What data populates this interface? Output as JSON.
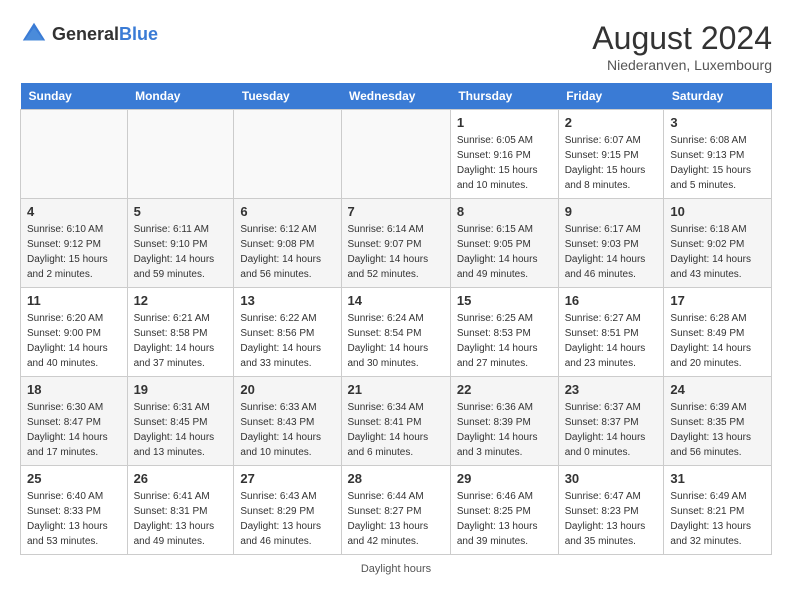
{
  "header": {
    "logo_general": "General",
    "logo_blue": "Blue",
    "month_year": "August 2024",
    "location": "Niederanven, Luxembourg"
  },
  "days_of_week": [
    "Sunday",
    "Monday",
    "Tuesday",
    "Wednesday",
    "Thursday",
    "Friday",
    "Saturday"
  ],
  "weeks": [
    [
      {
        "day": "",
        "info": ""
      },
      {
        "day": "",
        "info": ""
      },
      {
        "day": "",
        "info": ""
      },
      {
        "day": "",
        "info": ""
      },
      {
        "day": "1",
        "info": "Sunrise: 6:05 AM\nSunset: 9:16 PM\nDaylight: 15 hours\nand 10 minutes."
      },
      {
        "day": "2",
        "info": "Sunrise: 6:07 AM\nSunset: 9:15 PM\nDaylight: 15 hours\nand 8 minutes."
      },
      {
        "day": "3",
        "info": "Sunrise: 6:08 AM\nSunset: 9:13 PM\nDaylight: 15 hours\nand 5 minutes."
      }
    ],
    [
      {
        "day": "4",
        "info": "Sunrise: 6:10 AM\nSunset: 9:12 PM\nDaylight: 15 hours\nand 2 minutes."
      },
      {
        "day": "5",
        "info": "Sunrise: 6:11 AM\nSunset: 9:10 PM\nDaylight: 14 hours\nand 59 minutes."
      },
      {
        "day": "6",
        "info": "Sunrise: 6:12 AM\nSunset: 9:08 PM\nDaylight: 14 hours\nand 56 minutes."
      },
      {
        "day": "7",
        "info": "Sunrise: 6:14 AM\nSunset: 9:07 PM\nDaylight: 14 hours\nand 52 minutes."
      },
      {
        "day": "8",
        "info": "Sunrise: 6:15 AM\nSunset: 9:05 PM\nDaylight: 14 hours\nand 49 minutes."
      },
      {
        "day": "9",
        "info": "Sunrise: 6:17 AM\nSunset: 9:03 PM\nDaylight: 14 hours\nand 46 minutes."
      },
      {
        "day": "10",
        "info": "Sunrise: 6:18 AM\nSunset: 9:02 PM\nDaylight: 14 hours\nand 43 minutes."
      }
    ],
    [
      {
        "day": "11",
        "info": "Sunrise: 6:20 AM\nSunset: 9:00 PM\nDaylight: 14 hours\nand 40 minutes."
      },
      {
        "day": "12",
        "info": "Sunrise: 6:21 AM\nSunset: 8:58 PM\nDaylight: 14 hours\nand 37 minutes."
      },
      {
        "day": "13",
        "info": "Sunrise: 6:22 AM\nSunset: 8:56 PM\nDaylight: 14 hours\nand 33 minutes."
      },
      {
        "day": "14",
        "info": "Sunrise: 6:24 AM\nSunset: 8:54 PM\nDaylight: 14 hours\nand 30 minutes."
      },
      {
        "day": "15",
        "info": "Sunrise: 6:25 AM\nSunset: 8:53 PM\nDaylight: 14 hours\nand 27 minutes."
      },
      {
        "day": "16",
        "info": "Sunrise: 6:27 AM\nSunset: 8:51 PM\nDaylight: 14 hours\nand 23 minutes."
      },
      {
        "day": "17",
        "info": "Sunrise: 6:28 AM\nSunset: 8:49 PM\nDaylight: 14 hours\nand 20 minutes."
      }
    ],
    [
      {
        "day": "18",
        "info": "Sunrise: 6:30 AM\nSunset: 8:47 PM\nDaylight: 14 hours\nand 17 minutes."
      },
      {
        "day": "19",
        "info": "Sunrise: 6:31 AM\nSunset: 8:45 PM\nDaylight: 14 hours\nand 13 minutes."
      },
      {
        "day": "20",
        "info": "Sunrise: 6:33 AM\nSunset: 8:43 PM\nDaylight: 14 hours\nand 10 minutes."
      },
      {
        "day": "21",
        "info": "Sunrise: 6:34 AM\nSunset: 8:41 PM\nDaylight: 14 hours\nand 6 minutes."
      },
      {
        "day": "22",
        "info": "Sunrise: 6:36 AM\nSunset: 8:39 PM\nDaylight: 14 hours\nand 3 minutes."
      },
      {
        "day": "23",
        "info": "Sunrise: 6:37 AM\nSunset: 8:37 PM\nDaylight: 14 hours\nand 0 minutes."
      },
      {
        "day": "24",
        "info": "Sunrise: 6:39 AM\nSunset: 8:35 PM\nDaylight: 13 hours\nand 56 minutes."
      }
    ],
    [
      {
        "day": "25",
        "info": "Sunrise: 6:40 AM\nSunset: 8:33 PM\nDaylight: 13 hours\nand 53 minutes."
      },
      {
        "day": "26",
        "info": "Sunrise: 6:41 AM\nSunset: 8:31 PM\nDaylight: 13 hours\nand 49 minutes."
      },
      {
        "day": "27",
        "info": "Sunrise: 6:43 AM\nSunset: 8:29 PM\nDaylight: 13 hours\nand 46 minutes."
      },
      {
        "day": "28",
        "info": "Sunrise: 6:44 AM\nSunset: 8:27 PM\nDaylight: 13 hours\nand 42 minutes."
      },
      {
        "day": "29",
        "info": "Sunrise: 6:46 AM\nSunset: 8:25 PM\nDaylight: 13 hours\nand 39 minutes."
      },
      {
        "day": "30",
        "info": "Sunrise: 6:47 AM\nSunset: 8:23 PM\nDaylight: 13 hours\nand 35 minutes."
      },
      {
        "day": "31",
        "info": "Sunrise: 6:49 AM\nSunset: 8:21 PM\nDaylight: 13 hours\nand 32 minutes."
      }
    ]
  ],
  "footer": {
    "note": "Daylight hours"
  }
}
